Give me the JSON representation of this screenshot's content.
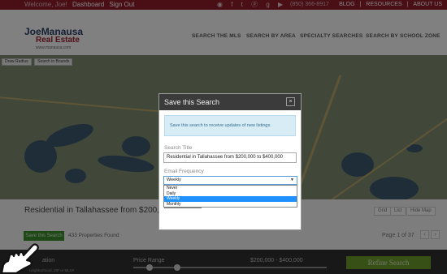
{
  "topbar": {
    "welcome": "Welcome, Joe!",
    "dashboard": "Dashboard",
    "sign_out": "Sign Out",
    "social_icons": [
      "rss-icon",
      "facebook-icon",
      "twitter-icon",
      "pinterest-icon",
      "google-plus-icon",
      "youtube-icon"
    ],
    "social_glyphs": "◉ f t ⓟ g ▶",
    "phone": "(850) 366-8917",
    "links": [
      "BLOG",
      "RESOURCES",
      "ABOUT US"
    ]
  },
  "logo": {
    "line1a": "Joe",
    "line1b": "Manausa",
    "line2": "Real Estate",
    "line3": "www.manausa.com"
  },
  "nav": [
    "SEARCH THE MLS",
    "SEARCH BY AREA",
    "SPECIALTY SEARCHES",
    "SEARCH BY SCHOOL ZONE"
  ],
  "map_tools": {
    "draw_radius": "Draw Radius",
    "search_in_bounds": "Search in Bounds"
  },
  "results": {
    "title": "Residential in Tallahassee from $200,00",
    "views": [
      "Grid",
      "List",
      "Hide Map"
    ],
    "save_button": "Save this Search",
    "count": "433 Properties Found",
    "page": "Page 1 of 37"
  },
  "filters": {
    "location_label": "ation",
    "location_hint": "neighborhood, ZIP or MLS#",
    "price_label": "Price Range",
    "price_range": "$200,000 - $400,000",
    "refine_button": "Refine Search"
  },
  "modal": {
    "title": "Save this Search",
    "close": "×",
    "info": "Save this search to receive updates of new listings.",
    "title_label": "Search Title",
    "title_value": "Residential in Tallahassee from $200,000 to $400,000",
    "frequency_label": "Email Frequency",
    "frequency_selected": "Weekly",
    "frequency_options": [
      "Never",
      "Daily",
      "Weekly",
      "Monthly"
    ],
    "highlighted_option": "Weekly"
  },
  "colors": {
    "brand_red": "#8c1d2a",
    "save_green": "#3a8a2a",
    "refine_green": "#6a9a2a",
    "select_blue": "#1e90ff"
  }
}
